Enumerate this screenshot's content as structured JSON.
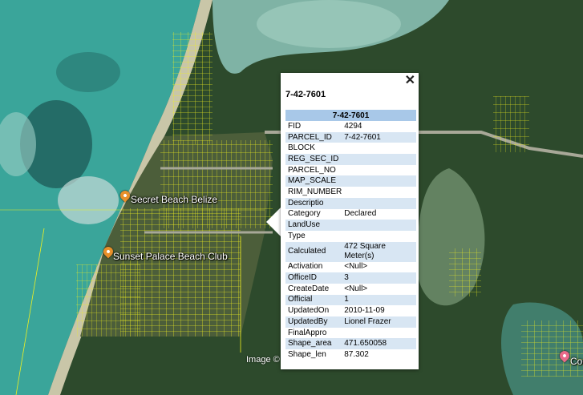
{
  "map": {
    "attribution": "Image ©",
    "pois": [
      {
        "name": "secret-beach-belize",
        "label": "Secret Beach Belize",
        "color": "#e8902a"
      },
      {
        "name": "sunset-palace-beach-club",
        "label": "Sunset Palace Beach Club",
        "color": "#e8902a"
      },
      {
        "name": "coco",
        "label": "Coc",
        "color": "#e86a8a"
      }
    ],
    "colors": {
      "parcel_lines": "#f0f020",
      "sea": "#3aa59a",
      "land": "#2f4a2c"
    }
  },
  "popup": {
    "title": "7-42-7601",
    "table_header": "7-42-7601",
    "close_icon": "close-icon",
    "rows": [
      {
        "key": "FID",
        "value": "4294"
      },
      {
        "key": "PARCEL_ID",
        "value": "7-42-7601"
      },
      {
        "key": "BLOCK",
        "value": ""
      },
      {
        "key": "REG_SEC_ID",
        "value": ""
      },
      {
        "key": "PARCEL_NO",
        "value": ""
      },
      {
        "key": "MAP_SCALE",
        "value": ""
      },
      {
        "key": "RIM_NUMBER",
        "value": ""
      },
      {
        "key": "Descriptio",
        "value": ""
      },
      {
        "key": "Category",
        "value": "Declared"
      },
      {
        "key": "LandUse",
        "value": ""
      },
      {
        "key": "Type",
        "value": ""
      },
      {
        "key": "Calculated",
        "value": "472 Square Meter(s)"
      },
      {
        "key": "Activation",
        "value": "<Null>"
      },
      {
        "key": "OfficeID",
        "value": "3"
      },
      {
        "key": "CreateDate",
        "value": "<Null>"
      },
      {
        "key": "Official",
        "value": "1"
      },
      {
        "key": "UpdatedOn",
        "value": "2010-11-09"
      },
      {
        "key": "UpdatedBy",
        "value": "Lionel Frazer"
      },
      {
        "key": "FinalAppro",
        "value": ""
      },
      {
        "key": "Shape_area",
        "value": "471.650058"
      },
      {
        "key": "Shape_len",
        "value": "87.302"
      }
    ]
  }
}
